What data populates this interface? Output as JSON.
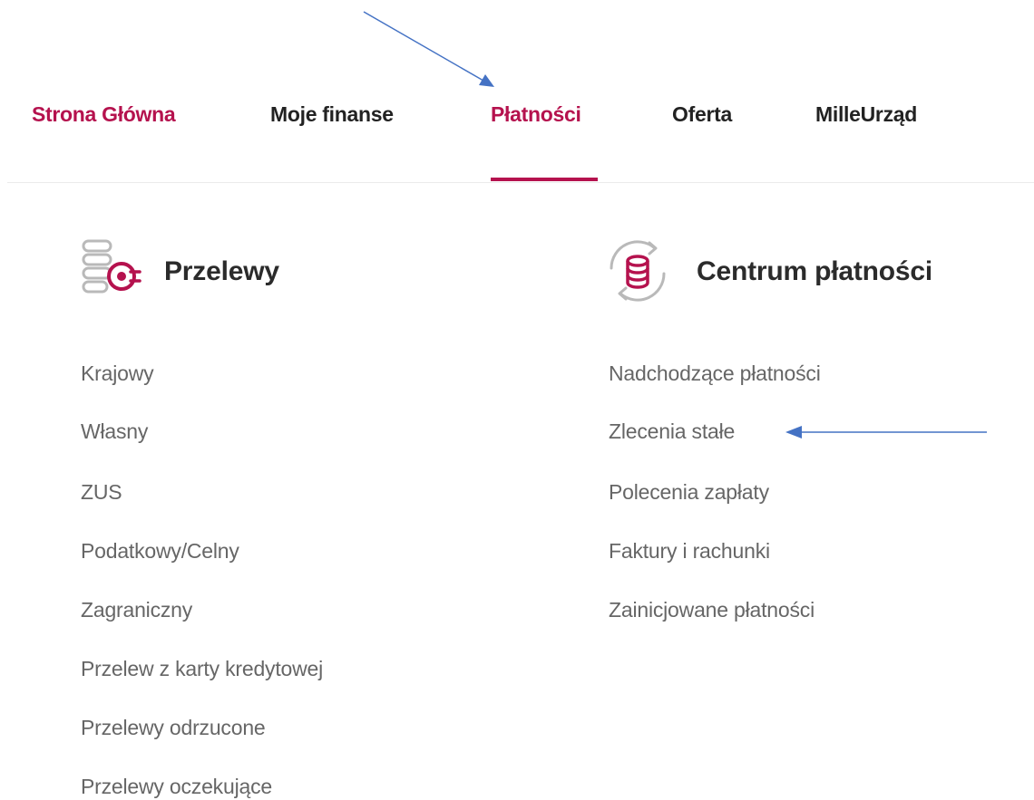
{
  "nav": {
    "items": [
      {
        "label": "Strona Główna"
      },
      {
        "label": "Moje finanse"
      },
      {
        "label": "Płatności"
      },
      {
        "label": "Oferta"
      },
      {
        "label": "MilleUrząd"
      }
    ],
    "active": "Płatności"
  },
  "sections": [
    {
      "title": "Przelewy",
      "icon": "transfers-icon",
      "links": [
        "Krajowy",
        "Własny",
        "ZUS",
        "Podatkowy/Celny",
        "Zagraniczny",
        "Przelew z karty kredytowej",
        "Przelewy odrzucone",
        "Przelewy oczekujące"
      ]
    },
    {
      "title": "Centrum płatności",
      "icon": "payment-center-icon",
      "links": [
        "Nadchodzące płatności",
        "Zlecenia stałe",
        "Polecenia zapłaty",
        "Faktury i rachunki",
        "Zainicjowane płatności"
      ]
    }
  ],
  "colors": {
    "accent": "#b5124e",
    "annotation_arrow": "#4472c4",
    "link_text": "#666666",
    "nav_text": "#222222"
  }
}
